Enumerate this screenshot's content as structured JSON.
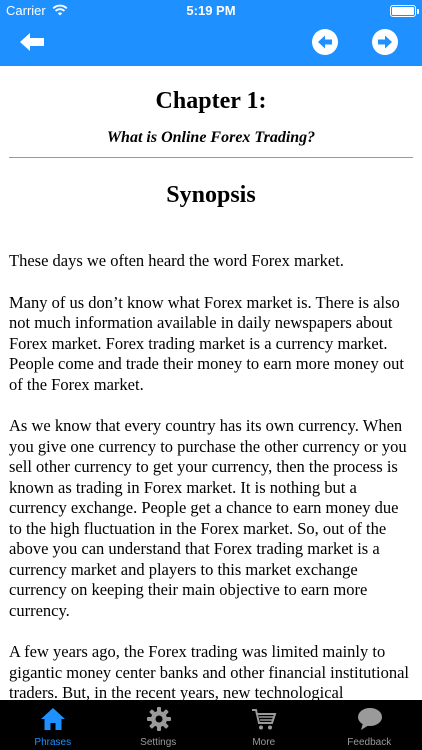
{
  "status_bar": {
    "carrier": "Carrier",
    "time": "5:19 PM"
  },
  "chapter": {
    "title": "Chapter 1:",
    "subtitle": "What is Online Forex Trading?",
    "section_heading": "Synopsis",
    "paragraphs": [
      "These days we often heard the word Forex market.",
      "Many of us don’t know what Forex market is. There is also not much information available in daily newspapers about Forex market. Forex trading market is a currency market. People come and trade their money to earn more money out of the Forex market.",
      "As we know that every country has its own currency. When you give one currency to purchase the other currency or you sell other currency to get your currency, then the process is known as trading in Forex market. It is nothing but a currency exchange. People get a chance to earn money due to the high fluctuation in the Forex market. So, out of the above you can understand that Forex trading market is a currency market and players to this market exchange currency on keeping their main objective to earn more currency.",
      "A few years ago, the Forex trading was limited mainly to gigantic money center banks and other financial institutional traders. But, in the recent years, new technological innovations and development of the online trading software"
    ]
  },
  "tabs": [
    {
      "label": "Phrases",
      "icon": "home-icon",
      "active": true
    },
    {
      "label": "Settings",
      "icon": "gear-icon",
      "active": false
    },
    {
      "label": "More",
      "icon": "cart-icon",
      "active": false
    },
    {
      "label": "Feedback",
      "icon": "speech-bubble-icon",
      "active": false
    }
  ],
  "colors": {
    "accent": "#1e90ff",
    "tabbar_bg": "#000000",
    "inactive_tab": "#9a9a9a"
  }
}
